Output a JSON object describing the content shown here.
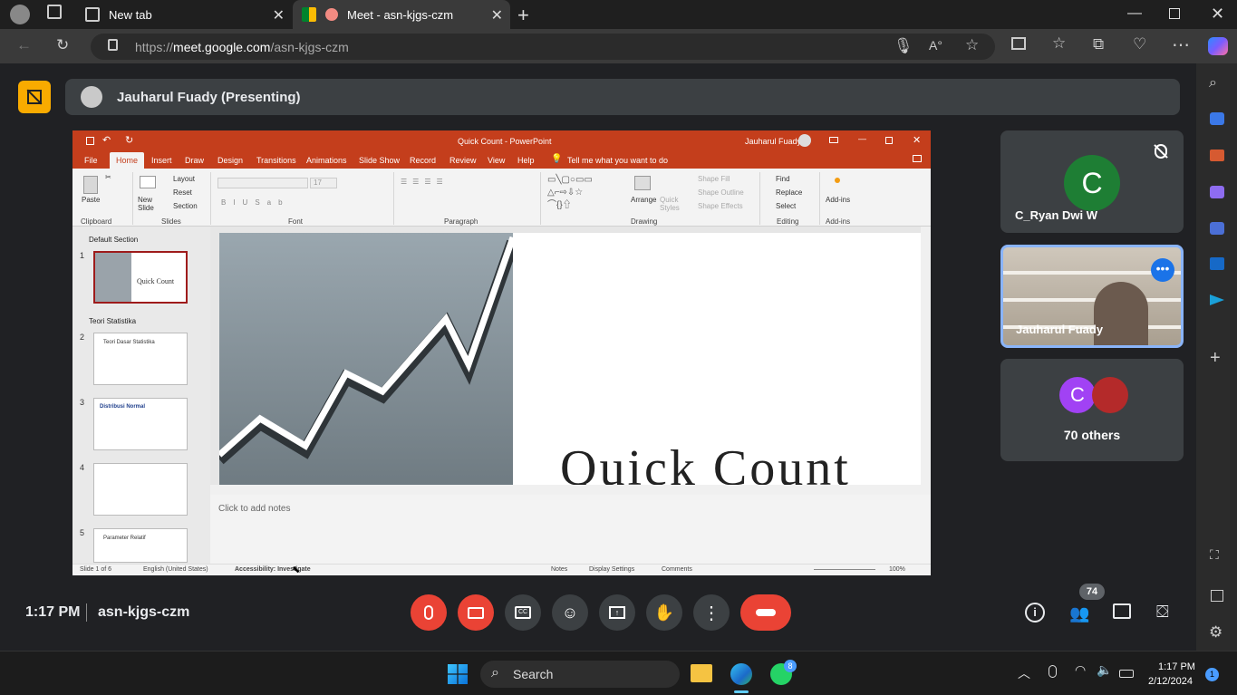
{
  "browser": {
    "tabs": [
      {
        "label": "New tab"
      },
      {
        "label": "Meet - asn-kjgs-czm"
      }
    ],
    "url_prefix": "https://",
    "url_host": "meet.google.com",
    "url_path": "/asn-kjgs-czm"
  },
  "meet": {
    "presenter_label": "Jauharul Fuady (Presenting)",
    "time": "1:17 PM",
    "meeting_code": "asn-kjgs-czm",
    "participants_count": "74",
    "tiles": [
      {
        "initial": "C",
        "name": "C_Ryan Dwi W",
        "color": "#1e7e34"
      },
      {
        "name": "Jauharul Fuady"
      },
      {
        "initial": "C",
        "label": "70 others",
        "color": "#a142f4"
      }
    ]
  },
  "powerpoint": {
    "doc_title": "Quick Count  -  PowerPoint",
    "user": "Jauharul Fuady",
    "menu_tabs": [
      "File",
      "Home",
      "Insert",
      "Draw",
      "Design",
      "Transitions",
      "Animations",
      "Slide Show",
      "Record",
      "Review",
      "View",
      "Help"
    ],
    "tell_me": "Tell me what you want to do",
    "ribbon": {
      "paste": "Paste",
      "new_slide": "New Slide",
      "layout": "Layout",
      "reset": "Reset",
      "section": "Section",
      "font_size": "17",
      "arrange": "Arrange",
      "quick_styles": "Quick Styles",
      "shape_fill": "Shape Fill",
      "shape_outline": "Shape Outline",
      "shape_effects": "Shape Effects",
      "find": "Find",
      "replace": "Replace",
      "select": "Select",
      "addins": "Add-ins",
      "groups": [
        "Clipboard",
        "Slides",
        "Font",
        "Paragraph",
        "Drawing",
        "Editing",
        "Add-ins"
      ]
    },
    "sections": [
      "Default Section",
      "Teori Statistika"
    ],
    "thumbnails": [
      {
        "num": "1",
        "title": "Quick Count"
      },
      {
        "num": "2",
        "title": "Teori Dasar Statistika"
      },
      {
        "num": "3",
        "title": "Distribusi Normal"
      },
      {
        "num": "4",
        "title": ""
      },
      {
        "num": "5",
        "title": "Parameter Relatif"
      }
    ],
    "slide_title": "Quick Count",
    "notes_placeholder": "Click to add notes",
    "status": {
      "slide": "Slide 1 of 6",
      "lang": "English (United States)",
      "accessibility": "Accessibility: Investigate",
      "notes": "Notes",
      "display": "Display Settings",
      "comments": "Comments",
      "zoom": "100%"
    }
  },
  "taskbar": {
    "search": "Search",
    "time": "1:17 PM",
    "date": "2/12/2024",
    "whatsapp_badge": "8",
    "notif_badge": "1"
  }
}
